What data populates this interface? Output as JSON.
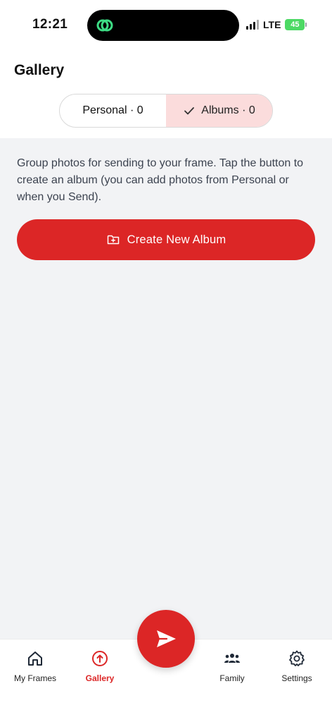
{
  "status_bar": {
    "time": "12:21",
    "network": "LTE",
    "battery": "45"
  },
  "header": {
    "title": "Gallery"
  },
  "segmented": {
    "tabs": [
      {
        "label": "Personal · 0",
        "active": false
      },
      {
        "label": "Albums · 0",
        "active": true
      }
    ]
  },
  "main": {
    "description": "Group photos for sending to your frame. Tap the button to create an album (you can add photos from Personal or when you Send).",
    "create_button_label": "Create New Album"
  },
  "bottom_nav": {
    "items": [
      {
        "label": "My Frames",
        "icon": "home-icon",
        "active": false
      },
      {
        "label": "Gallery",
        "icon": "upload-circle-icon",
        "active": true
      },
      {
        "label": "Family",
        "icon": "people-icon",
        "active": false
      },
      {
        "label": "Settings",
        "icon": "gear-icon",
        "active": false
      }
    ],
    "fab_icon": "send-icon"
  },
  "colors": {
    "accent": "#dc2626",
    "active_tab_bg": "#fbdcdc",
    "content_bg": "#f2f3f5"
  }
}
